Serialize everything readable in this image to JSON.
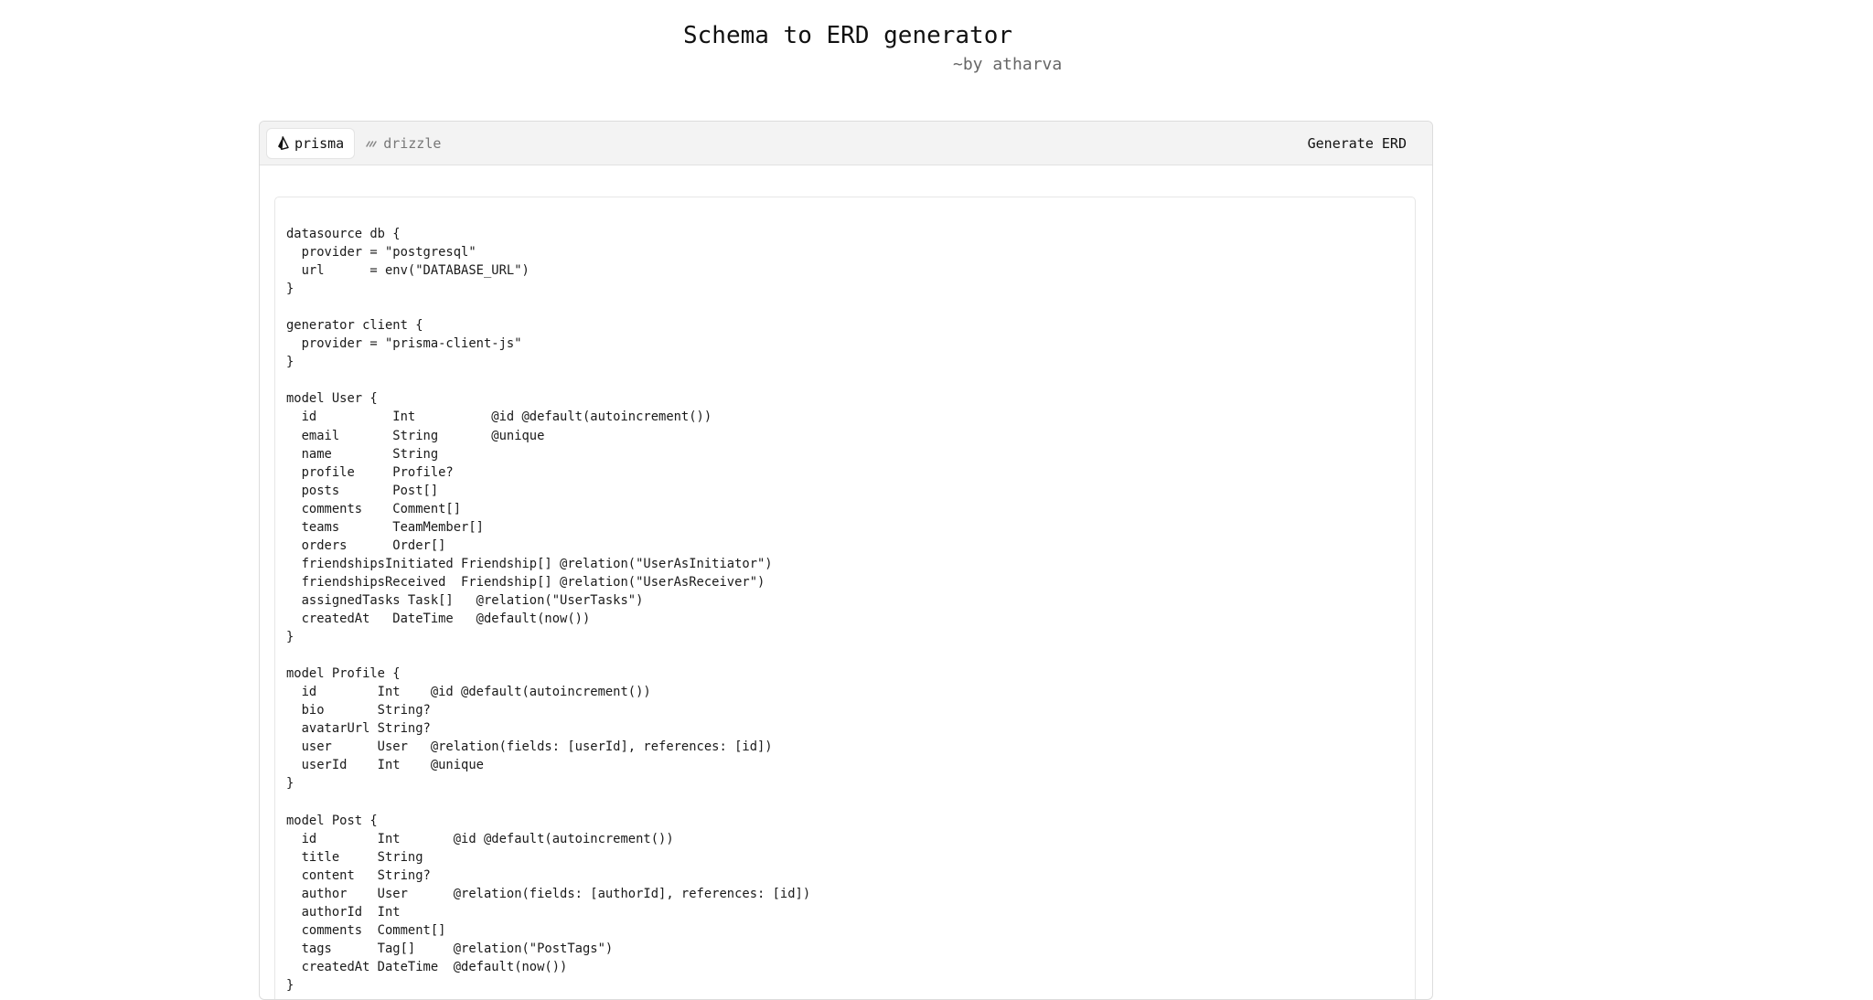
{
  "header": {
    "title": "Schema to ERD generator",
    "subtitle": "~by atharva"
  },
  "toolbar": {
    "tabs": [
      {
        "label": "prisma",
        "icon": "prisma-icon",
        "active": true
      },
      {
        "label": "drizzle",
        "icon": "drizzle-icon",
        "active": false
      }
    ],
    "generate_label": "Generate ERD"
  },
  "editor": {
    "language": "prisma",
    "lines": [
      "datasource db {",
      "  provider = \"postgresql\"",
      "  url      = env(\"DATABASE_URL\")",
      "}",
      "",
      "generator client {",
      "  provider = \"prisma-client-js\"",
      "}",
      "",
      "model User {",
      "  id          Int          @id @default(autoincrement())",
      "  email       String       @unique",
      "  name        String",
      "  profile     Profile?",
      "  posts       Post[]",
      "  comments    Comment[]",
      "  teams       TeamMember[]",
      "  orders      Order[]",
      "  friendshipsInitiated Friendship[] @relation(\"UserAsInitiator\")",
      "  friendshipsReceived  Friendship[] @relation(\"UserAsReceiver\")",
      "  assignedTasks Task[]   @relation(\"UserTasks\")",
      "  createdAt   DateTime   @default(now())",
      "}",
      "",
      "model Profile {",
      "  id        Int    @id @default(autoincrement())",
      "  bio       String?",
      "  avatarUrl String?",
      "  user      User   @relation(fields: [userId], references: [id])",
      "  userId    Int    @unique",
      "}",
      "",
      "model Post {",
      "  id        Int       @id @default(autoincrement())",
      "  title     String",
      "  content   String?",
      "  author    User      @relation(fields: [authorId], references: [id])",
      "  authorId  Int",
      "  comments  Comment[]",
      "  tags      Tag[]     @relation(\"PostTags\")",
      "  createdAt DateTime  @default(now())",
      "}"
    ]
  }
}
